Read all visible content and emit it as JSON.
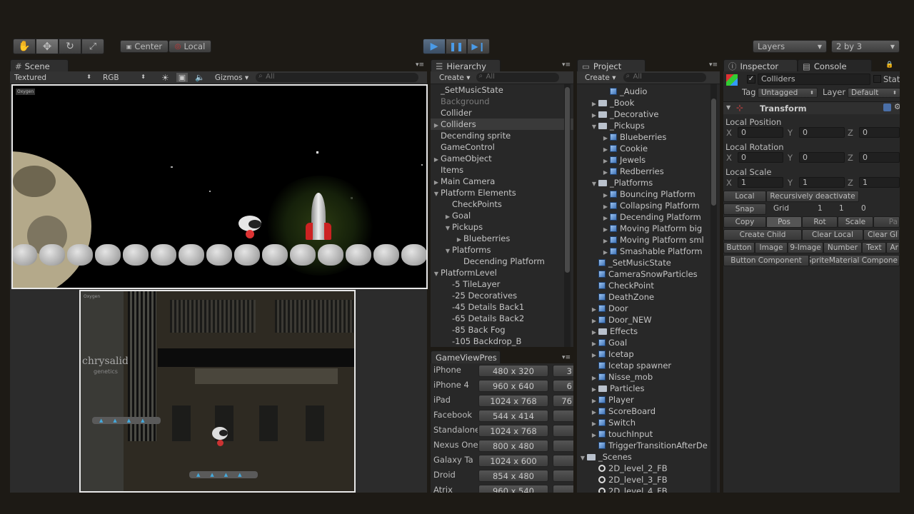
{
  "toolbar": {
    "pivot_center": "Center",
    "pivot_local": "Local",
    "layers": "Layers",
    "layout": "2 by 3"
  },
  "scene": {
    "tab": "Scene",
    "render_mode": "Textured",
    "color_mode": "RGB",
    "gizmos": "Gizmos ▾",
    "search_placeholder": "All"
  },
  "hierarchy": {
    "tab": "Hierarchy",
    "create": "Create ▾",
    "search_placeholder": "All",
    "items": [
      {
        "label": "_SetMusicState",
        "indent": 0,
        "arrow": ""
      },
      {
        "label": "Background",
        "indent": 0,
        "arrow": "",
        "dim": true
      },
      {
        "label": "Collider",
        "indent": 0,
        "arrow": ""
      },
      {
        "label": "Colliders",
        "indent": 0,
        "arrow": "▶",
        "selected": true
      },
      {
        "label": "Decending sprite",
        "indent": 0,
        "arrow": ""
      },
      {
        "label": "GameControl",
        "indent": 0,
        "arrow": ""
      },
      {
        "label": "GameObject",
        "indent": 0,
        "arrow": "▶"
      },
      {
        "label": "Items",
        "indent": 0,
        "arrow": ""
      },
      {
        "label": "Main Camera",
        "indent": 0,
        "arrow": "▶"
      },
      {
        "label": "Platform Elements",
        "indent": 0,
        "arrow": "▼"
      },
      {
        "label": "CheckPoints",
        "indent": 1,
        "arrow": ""
      },
      {
        "label": "Goal",
        "indent": 1,
        "arrow": "▶"
      },
      {
        "label": "Pickups",
        "indent": 1,
        "arrow": "▼"
      },
      {
        "label": "Blueberries",
        "indent": 2,
        "arrow": "▶"
      },
      {
        "label": "Platforms",
        "indent": 1,
        "arrow": "▼"
      },
      {
        "label": "Decending Platform",
        "indent": 2,
        "arrow": ""
      },
      {
        "label": "PlatformLevel",
        "indent": 0,
        "arrow": "▼"
      },
      {
        "label": "-5 TileLayer",
        "indent": 1,
        "arrow": ""
      },
      {
        "label": "-25 Decoratives",
        "indent": 1,
        "arrow": ""
      },
      {
        "label": "-45 Details Back1",
        "indent": 1,
        "arrow": ""
      },
      {
        "label": "-65 Details Back2",
        "indent": 1,
        "arrow": ""
      },
      {
        "label": "-85 Back Fog",
        "indent": 1,
        "arrow": ""
      },
      {
        "label": "-105 Backdrop_B",
        "indent": 1,
        "arrow": ""
      }
    ]
  },
  "gameview": {
    "tab": "GameViewPres",
    "rows": [
      {
        "name": "iPhone",
        "res": "480 x 320",
        "next": "3"
      },
      {
        "name": "iPhone 4",
        "res": "960 x 640",
        "next": "6"
      },
      {
        "name": "iPad",
        "res": "1024 x 768",
        "next": "76"
      },
      {
        "name": "Facebook",
        "res": "544 x 414",
        "next": ""
      },
      {
        "name": "Standalone",
        "res": "1024 x 768",
        "next": ""
      },
      {
        "name": "Nexus One",
        "res": "800 x 480",
        "next": ""
      },
      {
        "name": "Galaxy Ta",
        "res": "1024 x 600",
        "next": ""
      },
      {
        "name": "Droid",
        "res": "854 x 480",
        "next": ""
      },
      {
        "name": "Atrix",
        "res": "960 x 540",
        "next": ""
      }
    ]
  },
  "project": {
    "tab": "Project",
    "create": "Create ▾",
    "search_placeholder": "All",
    "items": [
      {
        "label": "_Audio",
        "indent": 1,
        "arrow": "",
        "icon": "cube"
      },
      {
        "label": "_Book",
        "indent": 0,
        "arrow": "▶",
        "icon": "folder"
      },
      {
        "label": "_Decorative",
        "indent": 0,
        "arrow": "▶",
        "icon": "folder"
      },
      {
        "label": "_Pickups",
        "indent": 0,
        "arrow": "▼",
        "icon": "folder"
      },
      {
        "label": "Blueberries",
        "indent": 1,
        "arrow": "▶",
        "icon": "cube"
      },
      {
        "label": "Cookie",
        "indent": 1,
        "arrow": "▶",
        "icon": "cube"
      },
      {
        "label": "Jewels",
        "indent": 1,
        "arrow": "▶",
        "icon": "cube"
      },
      {
        "label": "Redberries",
        "indent": 1,
        "arrow": "▶",
        "icon": "cube"
      },
      {
        "label": "_Platforms",
        "indent": 0,
        "arrow": "▼",
        "icon": "folder"
      },
      {
        "label": "Bouncing Platform",
        "indent": 1,
        "arrow": "▶",
        "icon": "cube"
      },
      {
        "label": "Collapsing Platform",
        "indent": 1,
        "arrow": "▶",
        "icon": "cube"
      },
      {
        "label": "Decending Platform",
        "indent": 1,
        "arrow": "▶",
        "icon": "cube"
      },
      {
        "label": "Moving Platform big",
        "indent": 1,
        "arrow": "▶",
        "icon": "cube"
      },
      {
        "label": "Moving Platform sml",
        "indent": 1,
        "arrow": "▶",
        "icon": "cube"
      },
      {
        "label": "Smashable Platform",
        "indent": 1,
        "arrow": "▶",
        "icon": "cube"
      },
      {
        "label": "_SetMusicState",
        "indent": 0,
        "arrow": "",
        "icon": "cube"
      },
      {
        "label": "CameraSnowParticles",
        "indent": 0,
        "arrow": "",
        "icon": "cube"
      },
      {
        "label": "CheckPoint",
        "indent": 0,
        "arrow": "",
        "icon": "cube"
      },
      {
        "label": "DeathZone",
        "indent": 0,
        "arrow": "",
        "icon": "cube"
      },
      {
        "label": "Door",
        "indent": 0,
        "arrow": "▶",
        "icon": "cube"
      },
      {
        "label": "Door_NEW",
        "indent": 0,
        "arrow": "▶",
        "icon": "cube"
      },
      {
        "label": "Effects",
        "indent": 0,
        "arrow": "▶",
        "icon": "folder"
      },
      {
        "label": "Goal",
        "indent": 0,
        "arrow": "▶",
        "icon": "cube"
      },
      {
        "label": "Icetap",
        "indent": 0,
        "arrow": "▶",
        "icon": "cube"
      },
      {
        "label": "Icetap spawner",
        "indent": 0,
        "arrow": "",
        "icon": "cube"
      },
      {
        "label": "Nisse_mob",
        "indent": 0,
        "arrow": "▶",
        "icon": "cube"
      },
      {
        "label": "Particles",
        "indent": 0,
        "arrow": "▶",
        "icon": "folder"
      },
      {
        "label": "Player",
        "indent": 0,
        "arrow": "▶",
        "icon": "cube"
      },
      {
        "label": "ScoreBoard",
        "indent": 0,
        "arrow": "▶",
        "icon": "cube"
      },
      {
        "label": "Switch",
        "indent": 0,
        "arrow": "▶",
        "icon": "cube"
      },
      {
        "label": "touchInput",
        "indent": 0,
        "arrow": "▶",
        "icon": "cube"
      },
      {
        "label": "TriggerTransitionAfterDe",
        "indent": 0,
        "arrow": "",
        "icon": "cube"
      },
      {
        "label": "_Scenes",
        "indent": -1,
        "arrow": "▼",
        "icon": "folder"
      },
      {
        "label": "2D_level_2_FB",
        "indent": 0,
        "arrow": "",
        "icon": "scene"
      },
      {
        "label": "2D_level_3_FB",
        "indent": 0,
        "arrow": "",
        "icon": "scene"
      },
      {
        "label": "2D_level_4_FB",
        "indent": 0,
        "arrow": "",
        "icon": "scene"
      }
    ]
  },
  "inspector": {
    "tab": "Inspector",
    "console_tab": "Console",
    "object_name": "Colliders",
    "static": "Stati",
    "tag_label": "Tag",
    "tag_value": "Untagged",
    "layer_label": "Layer",
    "layer_value": "Default",
    "component": "Transform",
    "local_position": "Local Position",
    "local_rotation": "Local Rotation",
    "local_scale": "Local Scale",
    "pos": {
      "x": "0",
      "y": "0",
      "z": "0"
    },
    "rot": {
      "x": "0",
      "y": "0",
      "z": "0"
    },
    "scale": {
      "x": "1",
      "y": "1",
      "z": "1"
    },
    "axis_x": "X",
    "axis_y": "Y",
    "axis_z": "Z",
    "local_btn": "Local",
    "recursive_btn": "Recursively deactivate",
    "snap": "Snap",
    "grid": "Grid",
    "grid_x": "1",
    "grid_y": "1",
    "grid_z": "0",
    "copy": "Copy",
    "pos_btn": "Pos",
    "rot_btn": "Rot",
    "scale_btn": "Scale",
    "paste": "Pa",
    "create_child": "Create Child",
    "clear_local": "Clear Local",
    "clear_gl": "Clear Gl",
    "btn_button": "Button",
    "btn_image": "Image",
    "btn_9image": "9-Image",
    "btn_number": "Number",
    "btn_text": "Text",
    "btn_ar": "Ar",
    "btn_component": "Button Component",
    "sprite_material": "SpriteMaterial Compone"
  },
  "game": {
    "logo_top": "Oxygen",
    "logo_bottom": "Oxygen",
    "chrysalid": "chrysalid",
    "genetics": "genetics"
  }
}
